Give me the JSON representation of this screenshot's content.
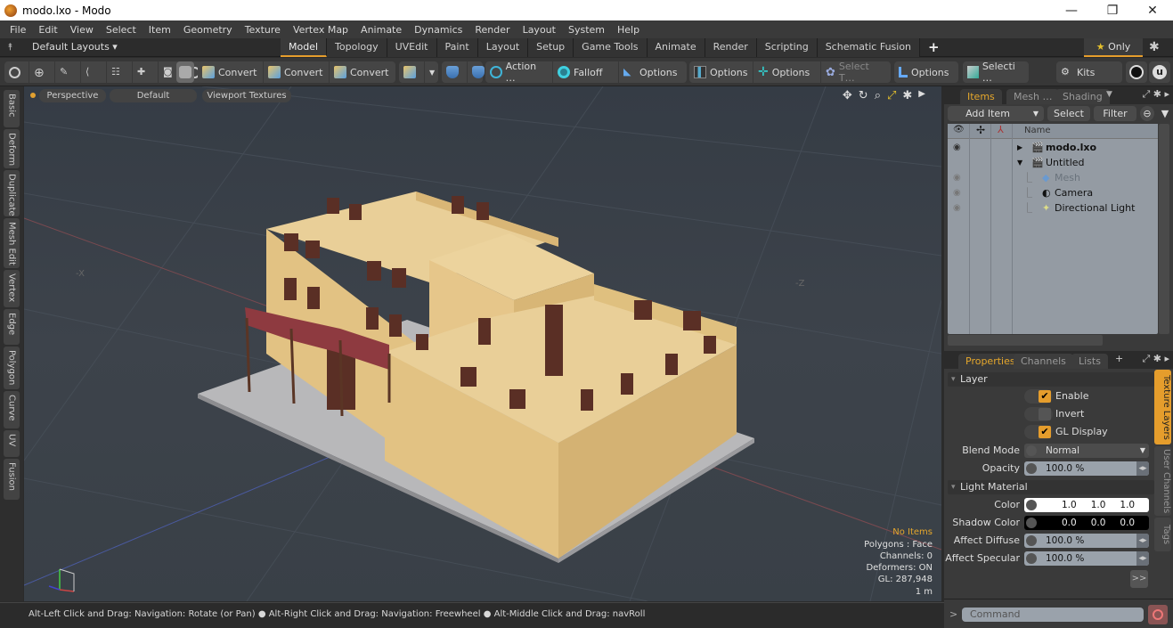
{
  "window": {
    "title": "modo.lxo - Modo",
    "minimize": "—",
    "maximize": "❐",
    "close": "✕"
  },
  "menu": [
    "File",
    "Edit",
    "View",
    "Select",
    "Item",
    "Geometry",
    "Texture",
    "Vertex Map",
    "Animate",
    "Dynamics",
    "Render",
    "Layout",
    "System",
    "Help"
  ],
  "layouts": {
    "label": "Default Layouts ▾",
    "tabs": [
      "Model",
      "Topology",
      "UVEdit",
      "Paint",
      "Layout",
      "Setup",
      "Game Tools",
      "Animate",
      "Render",
      "Scripting",
      "Schematic Fusion"
    ],
    "active": "Model",
    "add": "+",
    "only_label": "Only"
  },
  "toolbar": {
    "convert1": "Convert",
    "convert2": "Convert",
    "convert3": "Convert",
    "action": "Action  …",
    "falloff": "Falloff",
    "options1": "Options",
    "options2": "Options",
    "options3": "Options",
    "select_t": "Select T…",
    "options4": "Options",
    "selecti": "Selecti …",
    "kits": "Kits"
  },
  "left_tabs": [
    "Basic",
    "Deform",
    "Duplicate",
    "Mesh Edit",
    "Vertex",
    "Edge",
    "Polygon",
    "Curve",
    "UV",
    "Fusion"
  ],
  "viewport": {
    "view": "Perspective",
    "shading": "Default",
    "textures": "Viewport Textures",
    "info": {
      "selection": "No Items",
      "polygons": "Polygons : Face",
      "channels": "Channels: 0",
      "deformers": "Deformers: ON",
      "gl": "GL: 287,948",
      "scale": "1 m"
    },
    "axis_x": "-X",
    "axis_z": "-Z"
  },
  "status": {
    "hint": "Alt-Left Click and Drag: Navigation: Rotate (or Pan) ● Alt-Right Click and Drag: Navigation: Freewheel ● Alt-Middle Click and Drag: navRoll"
  },
  "items_panel": {
    "tabs": [
      "Items",
      "Mesh …",
      "Shading"
    ],
    "add_item": "Add Item",
    "select": "Select",
    "filter": "Filter",
    "name_header": "Name",
    "rows": [
      {
        "name": "modo.lxo",
        "bold": true
      },
      {
        "name": "Untitled"
      },
      {
        "name": "Mesh",
        "dim": true
      },
      {
        "name": "Camera"
      },
      {
        "name": "Directional Light"
      }
    ]
  },
  "properties_panel": {
    "tabs": [
      "Properties",
      "Channels",
      "Lists"
    ],
    "layer_section": "Layer",
    "enable": {
      "label": "Enable",
      "checked": true
    },
    "invert": {
      "label": "Invert",
      "checked": false
    },
    "gl_display": {
      "label": "GL Display",
      "checked": true
    },
    "blend_mode": {
      "label": "Blend Mode",
      "value": "Normal"
    },
    "opacity": {
      "label": "Opacity",
      "value": "100.0 %"
    },
    "light_section": "Light Material",
    "color": {
      "label": "Color",
      "r": "1.0",
      "g": "1.0",
      "b": "1.0"
    },
    "shadow_color": {
      "label": "Shadow Color",
      "r": "0.0",
      "g": "0.0",
      "b": "0.0"
    },
    "affect_diffuse": {
      "label": "Affect Diffuse",
      "value": "100.0 %"
    },
    "affect_specular": {
      "label": "Affect Specular",
      "value": "100.0 %"
    },
    "more": ">>",
    "side_tabs": [
      "Texture Layers",
      "User Channels",
      "Tags"
    ]
  },
  "command": {
    "placeholder": "Command",
    "prompt": ">"
  }
}
